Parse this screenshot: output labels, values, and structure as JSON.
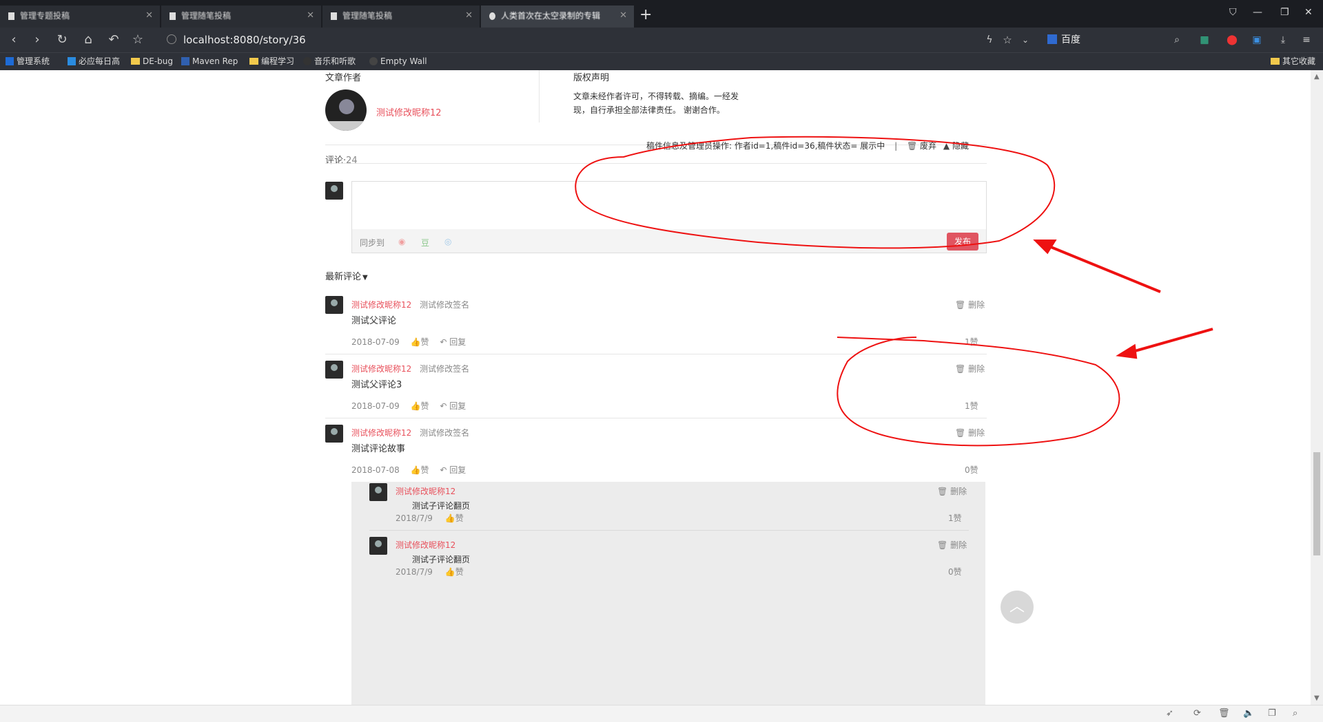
{
  "browser": {
    "tabs": [
      {
        "label": "管理专题投稿",
        "active": false
      },
      {
        "label": "管理随笔投稿",
        "active": false
      },
      {
        "label": "管理随笔投稿",
        "active": false
      },
      {
        "label": "人类首次在太空录制的专辑",
        "active": true
      }
    ],
    "address": "localhost:8080/story/36",
    "search_engine": "百度",
    "bookmarks": [
      "管理系统",
      "必应每日高",
      "DE-bug",
      "Maven Rep",
      "编程学习",
      "音乐和听歌",
      "Empty Wall"
    ],
    "bookmarks_right": "其它收藏"
  },
  "article": {
    "author_heading": "文章作者",
    "author_name": "测试修改昵称12",
    "copyright_heading": "版权声明",
    "copyright_text_line1": "文章未经作者许可，不得转载、摘编。一经发",
    "copyright_text_line2": "现，自行承担全部法律责任。 谢谢合作。",
    "admin_info": "稿件信息及管理员操作: 作者id=1,稿件id=36,稿件状态= 展示中",
    "admin_separator": "|",
    "abandon_label": "废弃",
    "hide_label": "隐藏"
  },
  "comments_section": {
    "label": "评论·",
    "count": "24",
    "sync_label": "同步到",
    "publish_label": "发布",
    "sort_label": "最新评论",
    "sort_icon": "▼"
  },
  "comments": [
    {
      "author": "测试修改昵称12",
      "signature": "测试修改签名",
      "text": "测试父评论",
      "date": "2018-07-09",
      "like_label": "赞",
      "reply_label": "回复",
      "likes": "1赞",
      "delete_label": "删除",
      "liked": true
    },
    {
      "author": "测试修改昵称12",
      "signature": "测试修改签名",
      "text": "测试父评论3",
      "date": "2018-07-09",
      "like_label": "赞",
      "reply_label": "回复",
      "likes": "1赞",
      "delete_label": "删除",
      "liked": true
    },
    {
      "author": "测试修改昵称12",
      "signature": "测试修改签名",
      "text": "测试评论故事",
      "date": "2018-07-08",
      "like_label": "赞",
      "reply_label": "回复",
      "likes": "0赞",
      "delete_label": "删除",
      "liked": false
    }
  ],
  "replies": [
    {
      "author": "测试修改昵称12",
      "text": "测试子评论翻页",
      "date": "2018/7/9",
      "like_label": "赞",
      "likes": "1赞",
      "delete_label": "删除",
      "liked": true
    },
    {
      "author": "测试修改昵称12",
      "text": "测试子评论翻页",
      "date": "2018/7/9",
      "like_label": "赞",
      "likes": "0赞",
      "delete_label": "删除",
      "liked": false
    }
  ],
  "colors": {
    "accent": "#e8505b",
    "annotation": "#ee1111"
  }
}
